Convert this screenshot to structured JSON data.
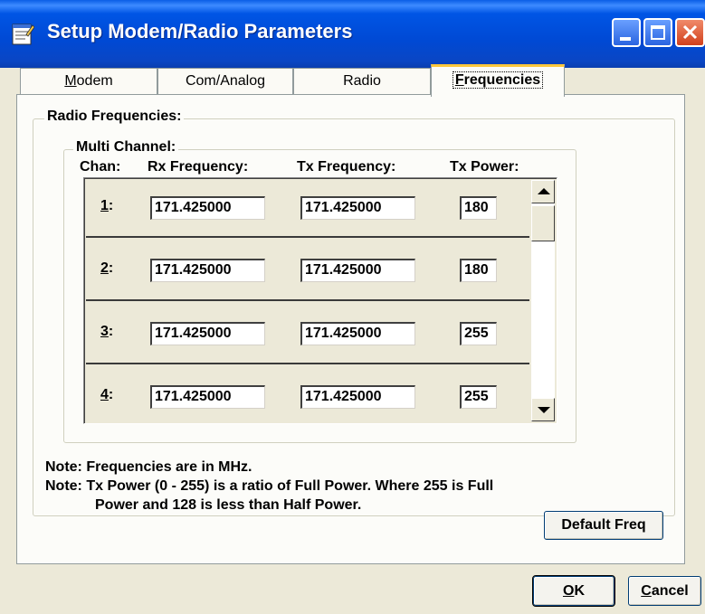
{
  "window": {
    "title": "Setup Modem/Radio Parameters",
    "icon": "notepad-icon",
    "title_bar_color": "#0a4fd9"
  },
  "tabs": [
    {
      "key": "M",
      "rest": "odem",
      "selected": false
    },
    {
      "key": "",
      "rest": "Com/Analog",
      "selected": false
    },
    {
      "key": "",
      "rest": "Radio",
      "selected": false
    },
    {
      "key": "F",
      "rest": "requencies",
      "selected": true
    }
  ],
  "radio_frequencies": {
    "group_title": "Radio Frequencies:",
    "multi_channel": {
      "group_title": "Multi Channel:",
      "headers": {
        "chan": "Chan:",
        "rx": "Rx Frequency:",
        "tx": "Tx Frequency:",
        "power": "Tx Power:"
      },
      "rows": [
        {
          "chan_key": "1",
          "chan_suffix": ":",
          "rx": "171.425000",
          "tx": "171.425000",
          "power": "180"
        },
        {
          "chan_key": "2",
          "chan_suffix": ":",
          "rx": "171.425000",
          "tx": "171.425000",
          "power": "180"
        },
        {
          "chan_key": "3",
          "chan_suffix": ":",
          "rx": "171.425000",
          "tx": "171.425000",
          "power": "255"
        },
        {
          "chan_key": "4",
          "chan_suffix": ":",
          "rx": "171.425000",
          "tx": "171.425000",
          "power": "255"
        }
      ]
    },
    "notes": [
      "Note: Frequencies are in MHz.",
      "Note: Tx Power (0 - 255) is a ratio of Full Power.  Where 255 is Full",
      "Power and 128 is less than Half Power."
    ],
    "default_button": "Default Freq"
  },
  "footer": {
    "ok": {
      "key": "O",
      "rest": "K"
    },
    "cancel": {
      "key": "C",
      "rest": "ancel"
    }
  }
}
